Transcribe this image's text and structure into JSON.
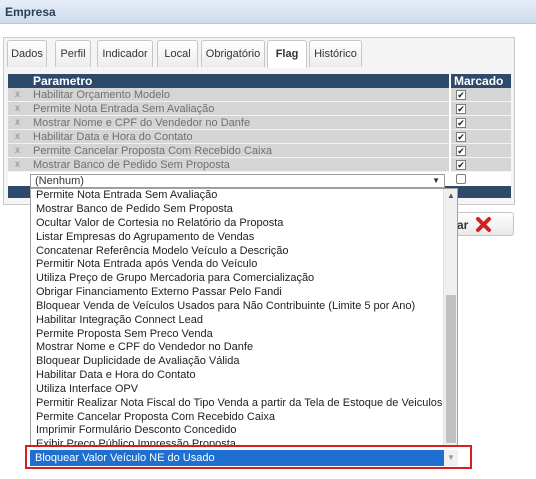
{
  "window": {
    "title": "Empresa"
  },
  "tabs": [
    {
      "label": "Dados"
    },
    {
      "label": "Perfil"
    },
    {
      "label": "Indicador"
    },
    {
      "label": "Local"
    },
    {
      "label": "Obrigatório"
    },
    {
      "label": "Flag",
      "active": true
    },
    {
      "label": "Histórico"
    }
  ],
  "grid": {
    "headers": {
      "parametro": "Parametro",
      "marcado": "Marcado"
    },
    "rows": [
      {
        "label": "Habilitar Orçamento Modelo",
        "checked": true
      },
      {
        "label": "Permite Nota Entrada Sem Avaliação",
        "checked": true
      },
      {
        "label": "Mostrar Nome e CPF do Vendedor no Danfe",
        "checked": true
      },
      {
        "label": "Habilitar Data e Hora do Contato",
        "checked": true
      },
      {
        "label": "Permite Cancelar Proposta Com Recebido Caixa",
        "checked": true
      },
      {
        "label": "Mostrar Banco de Pedido Sem Proposta",
        "checked": true
      }
    ],
    "delete_glyph": "x",
    "new_row": {
      "select_value": "(Nenhum)",
      "checked": false
    }
  },
  "close_button": {
    "label_visible": "ar"
  },
  "dropdown": {
    "options": [
      "Permite Nota Entrada Sem Avaliação",
      "Mostrar Banco de Pedido Sem Proposta",
      "Ocultar Valor de Cortesia no Relatório da Proposta",
      "Listar Empresas do Agrupamento de Vendas",
      "Concatenar Referência Modelo Veículo a Descrição",
      "Permitir Nota Entrada após Venda do Veículo",
      "Utiliza Preço de Grupo Mercadoria para Comercialização",
      "Obrigar Financiamento Externo Passar Pelo Fandi",
      "Bloquear Venda de Veículos Usados para Não Contribuinte (Limite 5 por Ano)",
      "Habilitar Integração Connect Lead",
      "Permite Proposta Sem Preco Venda",
      "Mostrar Nome e CPF do Vendedor no Danfe",
      "Bloquear Duplicidade de Avaliação Válida",
      "Habilitar Data e Hora do Contato",
      "Utiliza Interface OPV",
      "Permitir Realizar Nota Fiscal do Tipo Venda a partir da Tela de Estoque de Veiculos",
      "Permite Cancelar Proposta Com Recebido Caixa",
      "Imprimir Formulário Desconto Concedido",
      "Exibir Preço Público Impressão Proposta"
    ],
    "selected": "Bloquear Valor Veículo NE do Usado"
  },
  "colors": {
    "header_bg": "#2e4a6b",
    "selected_bg": "#1e6fd0",
    "highlight_frame": "#d42020",
    "close_icon": "#d42020"
  }
}
